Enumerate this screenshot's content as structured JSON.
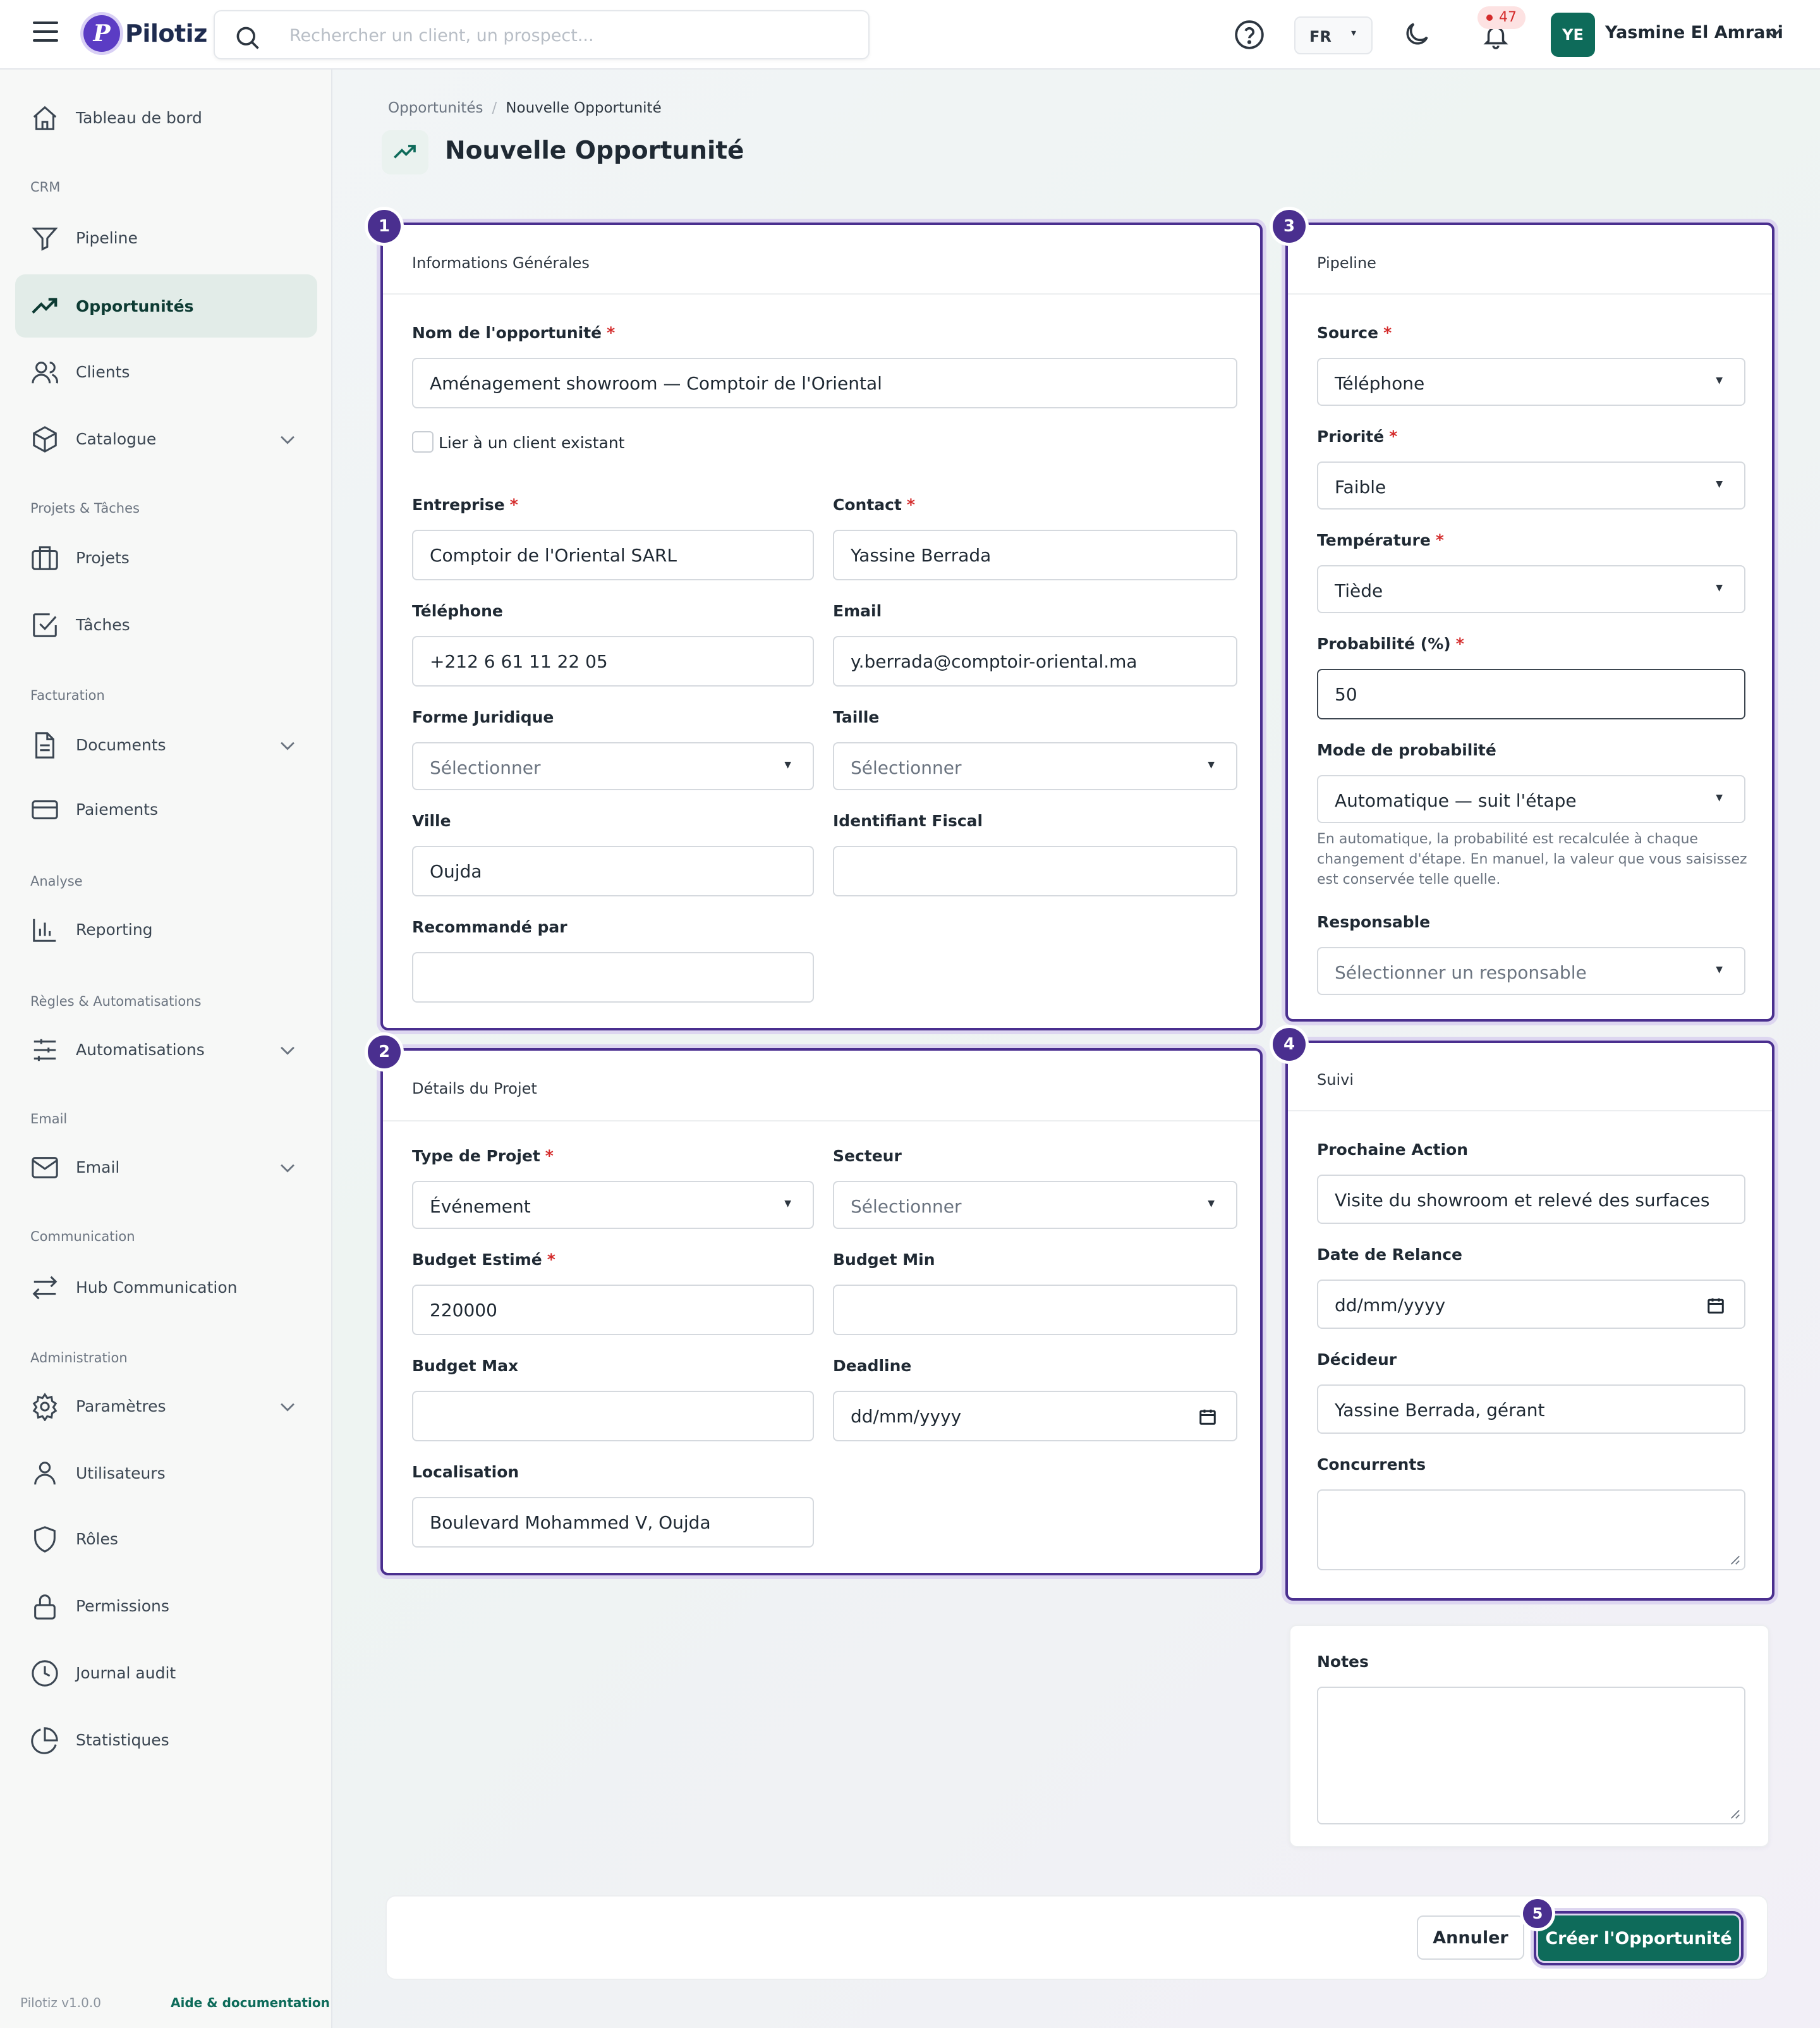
{
  "app": {
    "name": "Pilotiz",
    "logo_letter": "P",
    "version": "Pilotiz v1.0.0",
    "help_link": "Aide & documentation"
  },
  "topbar": {
    "search_placeholder": "Rechercher un client, un prospect...",
    "language": "FR",
    "notifications_count": "47",
    "user_initials": "YE",
    "user_name": "Yasmine El Amrani"
  },
  "sidebar": {
    "sections": [
      "CRM",
      "Projets & Tâches",
      "Facturation",
      "Analyse",
      "Règles & Automatisations",
      "Email",
      "Communication",
      "Administration"
    ],
    "items": [
      {
        "label": "Tableau de bord",
        "icon": "home-icon"
      },
      {
        "label": "Pipeline",
        "icon": "funnel-icon"
      },
      {
        "label": "Opportunités",
        "icon": "trending-up-icon",
        "active": true
      },
      {
        "label": "Clients",
        "icon": "users-icon"
      },
      {
        "label": "Catalogue",
        "icon": "box-icon",
        "expandable": true
      },
      {
        "label": "Projets",
        "icon": "briefcase-icon"
      },
      {
        "label": "Tâches",
        "icon": "checkbox-icon"
      },
      {
        "label": "Documents",
        "icon": "document-icon",
        "expandable": true
      },
      {
        "label": "Paiements",
        "icon": "credit-card-icon"
      },
      {
        "label": "Reporting",
        "icon": "bar-chart-icon"
      },
      {
        "label": "Automatisations",
        "icon": "sliders-icon",
        "expandable": true
      },
      {
        "label": "Email",
        "icon": "mail-icon",
        "expandable": true
      },
      {
        "label": "Hub Communication",
        "icon": "arrows-exchange-icon"
      },
      {
        "label": "Paramètres",
        "icon": "gear-icon",
        "expandable": true
      },
      {
        "label": "Utilisateurs",
        "icon": "user-icon"
      },
      {
        "label": "Rôles",
        "icon": "shield-icon"
      },
      {
        "label": "Permissions",
        "icon": "lock-icon"
      },
      {
        "label": "Journal audit",
        "icon": "clock-icon"
      },
      {
        "label": "Statistiques",
        "icon": "pie-chart-icon"
      }
    ]
  },
  "page": {
    "breadcrumb": [
      "Opportunités",
      "Nouvelle Opportunité"
    ],
    "title": "Nouvelle Opportunité"
  },
  "general": {
    "step": "1",
    "title": "Informations Générales",
    "name_label": "Nom de l'opportunité",
    "name_value": "Aménagement showroom — Comptoir de l'Oriental",
    "link_client_label": "Lier à un client existant",
    "company_label": "Entreprise",
    "company_value": "Comptoir de l'Oriental SARL",
    "contact_label": "Contact",
    "contact_value": "Yassine Berrada",
    "phone_label": "Téléphone",
    "phone_value": "+212 6 61 11 22 05",
    "email_label": "Email",
    "email_value": "y.berrada@comptoir-oriental.ma",
    "legal_form_label": "Forme Juridique",
    "legal_form_value": "Sélectionner",
    "size_label": "Taille",
    "size_value": "Sélectionner",
    "city_label": "Ville",
    "city_value": "Oujda",
    "tax_id_label": "Identifiant Fiscal",
    "tax_id_value": "",
    "referred_label": "Recommandé par",
    "referred_value": ""
  },
  "project": {
    "step": "2",
    "title": "Détails du Projet",
    "type_label": "Type de Projet",
    "type_value": "Événement",
    "sector_label": "Secteur",
    "sector_value": "Sélectionner",
    "budget_label": "Budget Estimé",
    "budget_value": "220000",
    "budget_min_label": "Budget Min",
    "budget_min_value": "",
    "budget_max_label": "Budget Max",
    "budget_max_value": "",
    "deadline_label": "Deadline",
    "deadline_value": "dd/mm/yyyy",
    "location_label": "Localisation",
    "location_value": "Boulevard Mohammed V, Oujda"
  },
  "pipeline": {
    "step": "3",
    "title": "Pipeline",
    "source_label": "Source",
    "source_value": "Téléphone",
    "priority_label": "Priorité",
    "priority_value": "Faible",
    "temperature_label": "Température",
    "temperature_value": "Tiède",
    "probability_label": "Probabilité (%)",
    "probability_value": "50",
    "mode_label": "Mode de probabilité",
    "mode_value": "Automatique — suit l'étape",
    "mode_help": [
      "En automatique, la probabilité est recalculée à chaque",
      "changement d'étape. En manuel, la valeur que vous saisissez",
      "est conservée telle quelle."
    ],
    "owner_label": "Responsable",
    "owner_value": "Sélectionner un responsable"
  },
  "followup": {
    "step": "4",
    "title": "Suivi",
    "next_action_label": "Prochaine Action",
    "next_action_value": "Visite du showroom et relevé des surfaces",
    "followup_date_label": "Date de Relance",
    "followup_date_value": "dd/mm/yyyy",
    "decision_maker_label": "Décideur",
    "decision_maker_value": "Yassine Berrada, gérant",
    "competitors_label": "Concurrents",
    "competitors_value": ""
  },
  "notes": {
    "label": "Notes",
    "value": ""
  },
  "actions": {
    "cancel": "Annuler",
    "create": "Créer l'Opportunité",
    "create_step": "5"
  },
  "colors": {
    "brand_teal": "#0e6b5a",
    "step_purple": "#4a2f8f",
    "required_red": "#d42a2a",
    "logo_purple": "#5b3cc4"
  }
}
